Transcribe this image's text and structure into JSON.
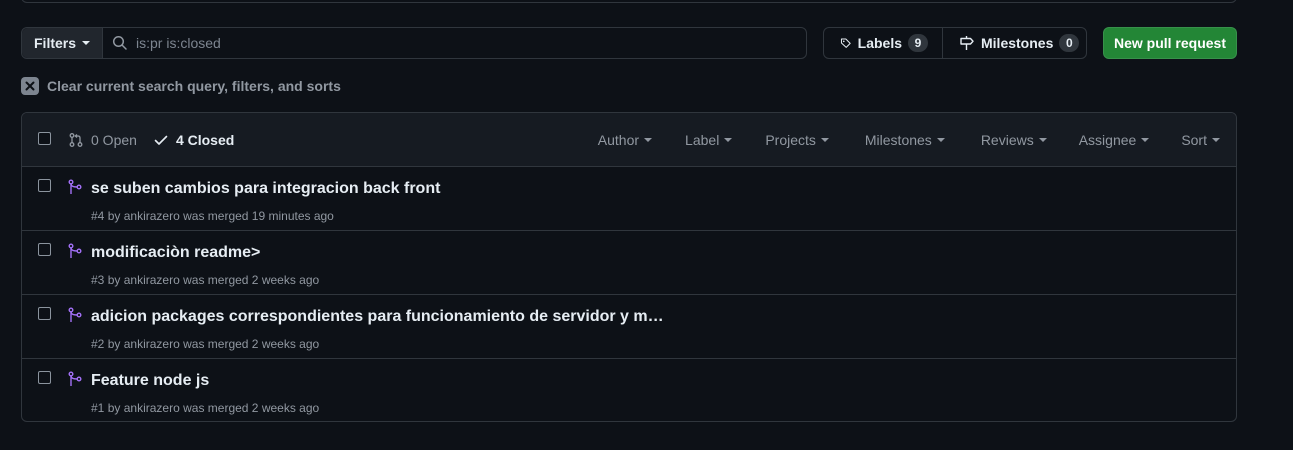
{
  "subnav": {
    "filters_label": "Filters",
    "search_value": "is:pr is:closed",
    "labels_label": "Labels",
    "labels_count": "9",
    "milestones_label": "Milestones",
    "milestones_count": "0",
    "new_pr_label": "New pull request"
  },
  "clear_filters": "Clear current search query, filters, and sorts",
  "list_header": {
    "open_label": "0 Open",
    "closed_label": "4 Closed",
    "filters": [
      "Author",
      "Label",
      "Projects",
      "Milestones",
      "Reviews",
      "Assignee",
      "Sort"
    ]
  },
  "pull_requests": [
    {
      "title": "se suben cambios para integracion back front",
      "number": "#4",
      "by": "by",
      "author": "ankirazero",
      "status": "was merged 19 minutes ago"
    },
    {
      "title": "modificaciòn readme>",
      "number": "#3",
      "by": "by",
      "author": "ankirazero",
      "status": "was merged 2 weeks ago"
    },
    {
      "title": "adicion packages correspondientes para funcionamiento de servidor y m…",
      "number": "#2",
      "by": "by",
      "author": "ankirazero",
      "status": "was merged 2 weeks ago"
    },
    {
      "title": "Feature node js",
      "number": "#1",
      "by": "by",
      "author": "ankirazero",
      "status": "was merged 2 weeks ago"
    }
  ],
  "colors": {
    "background": "#0d1117",
    "border": "#30363d",
    "header_bg": "#161b22",
    "merged_purple": "#a371f7",
    "primary_button": "#238636",
    "muted_text": "#9198a1"
  },
  "icons": [
    "search-icon",
    "tag-icon",
    "milestone-icon",
    "x-icon",
    "pull-request-icon",
    "check-icon",
    "merged-icon"
  ]
}
